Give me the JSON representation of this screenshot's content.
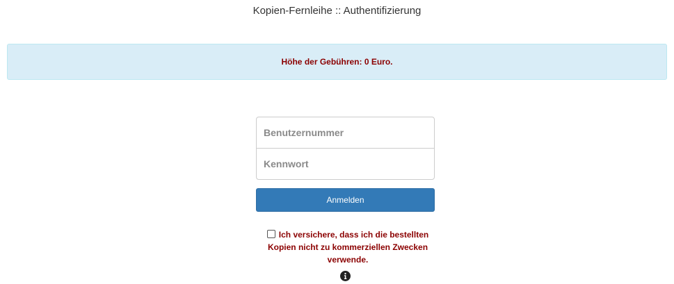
{
  "header": {
    "title": "Kopien-Fernleihe :: Authentifizierung"
  },
  "fee_banner": {
    "text": "Höhe der Gebühren: 0 Euro."
  },
  "login": {
    "username_placeholder": "Benutzernummer",
    "username_value": "",
    "password_placeholder": "Kennwort",
    "password_value": "",
    "submit_label": "Anmelden"
  },
  "consent": {
    "checked": false,
    "text": "Ich versichere, dass ich die bestellten Kopien nicht zu kommerziellen Zwecken verwende."
  },
  "icons": {
    "info": "info-circle-icon"
  },
  "colors": {
    "banner_background": "#d9edf7",
    "warning_text": "#8b0000",
    "primary_button": "#337ab7"
  }
}
